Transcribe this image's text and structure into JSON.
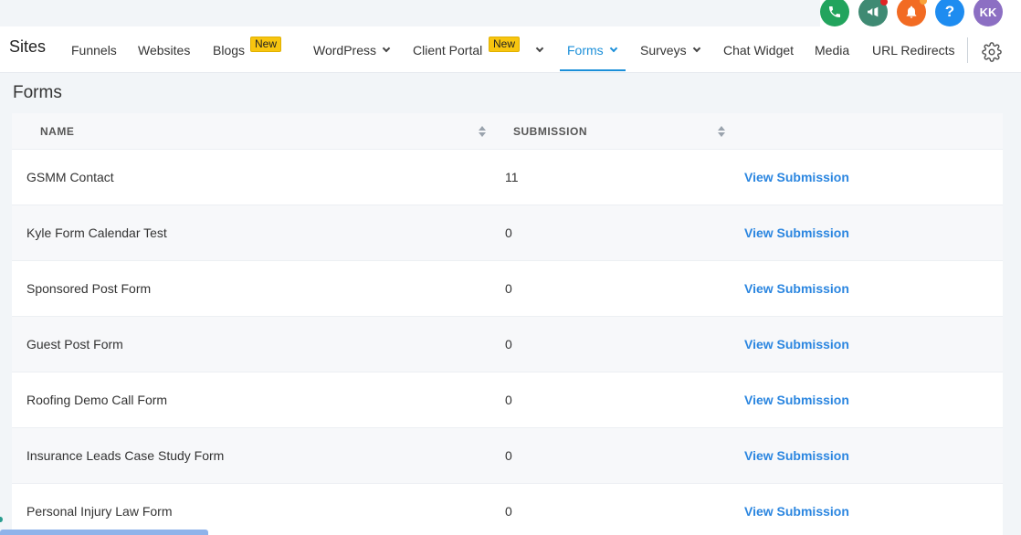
{
  "topbar": {
    "avatar_initials": "KK",
    "help_glyph": "?",
    "icons": [
      "phone-icon",
      "megaphone-icon",
      "bell-icon",
      "help-icon"
    ]
  },
  "nav": {
    "title": "Sites",
    "items": [
      {
        "label": "Funnels"
      },
      {
        "label": "Websites"
      },
      {
        "label": "Blogs",
        "badge": "New"
      },
      {
        "label": "WordPress"
      },
      {
        "label": "Client Portal",
        "badge": "New"
      },
      {
        "label": "Forms"
      },
      {
        "label": "Surveys"
      },
      {
        "label": "Chat Widget"
      },
      {
        "label": "Media"
      },
      {
        "label": "URL Redirects"
      }
    ]
  },
  "page": {
    "title": "Forms"
  },
  "table": {
    "headers": {
      "name": "NAME",
      "submission": "SUBMISSION"
    },
    "rows": [
      {
        "name": "GSMM Contact",
        "submissions": "11",
        "action": "View Submission"
      },
      {
        "name": "Kyle Form Calendar Test",
        "submissions": "0",
        "action": "View Submission"
      },
      {
        "name": "Sponsored Post Form",
        "submissions": "0",
        "action": "View Submission"
      },
      {
        "name": "Guest Post Form",
        "submissions": "0",
        "action": "View Submission"
      },
      {
        "name": "Roofing Demo Call Form",
        "submissions": "0",
        "action": "View Submission"
      },
      {
        "name": "Insurance Leads Case Study Form",
        "submissions": "0",
        "action": "View Submission"
      },
      {
        "name": "Personal Injury Law Form",
        "submissions": "0",
        "action": "View Submission"
      }
    ]
  },
  "colors": {
    "accent": "#1b8fd9",
    "link": "#2b86e0",
    "badge": "#f8c50f"
  }
}
